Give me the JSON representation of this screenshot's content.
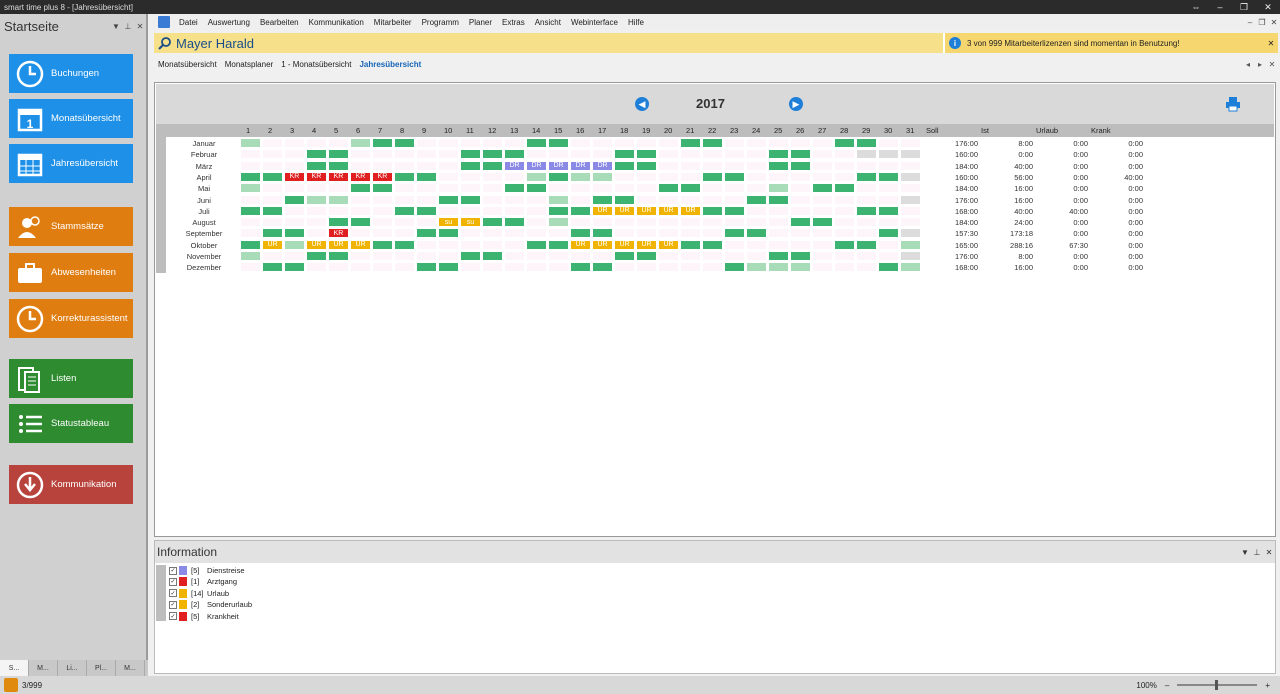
{
  "window": {
    "title": "smart time plus 8 - [Jahresübersicht]"
  },
  "sidebar": {
    "title": "Startseite",
    "buttons": [
      {
        "label": "Buchungen",
        "color": "#1e90e8",
        "icon": "clock-icon"
      },
      {
        "label": "Monatsübersicht",
        "color": "#1e90e8",
        "icon": "calendar-day-icon"
      },
      {
        "label": "Jahresübersicht",
        "color": "#1e90e8",
        "icon": "calendar-grid-icon"
      },
      {
        "label": "Stammsätze",
        "color": "#e07d10",
        "icon": "users-icon"
      },
      {
        "label": "Abwesenheiten",
        "color": "#e07d10",
        "icon": "briefcase-icon"
      },
      {
        "label": "Korrekturassistent",
        "color": "#e07d10",
        "icon": "clock-edit-icon"
      },
      {
        "label": "Listen",
        "color": "#2e8b30",
        "icon": "list-doc-icon"
      },
      {
        "label": "Statustableau",
        "color": "#2e8b30",
        "icon": "list-icon"
      },
      {
        "label": "Kommunikation",
        "color": "#b8433c",
        "icon": "download-icon"
      }
    ],
    "tabs": [
      "S...",
      "M...",
      "Li...",
      "Pl...",
      "M..."
    ]
  },
  "menu": [
    "Datei",
    "Auswertung",
    "Bearbeiten",
    "Kommunikation",
    "Mitarbeiter",
    "Programm",
    "Planer",
    "Extras",
    "Ansicht",
    "Webinterface",
    "Hilfe"
  ],
  "employee": {
    "name": "Mayer Harald"
  },
  "license_notice": "3 von 999 Mitarbeiterlizenzen sind momentan in Benutzung!",
  "subtabs": [
    "Monatsübersicht",
    "Monatsplaner",
    "1 - Monatsübersicht",
    "Jahresübersicht"
  ],
  "year": "2017",
  "columns": {
    "soll": "Soll",
    "ist": "Ist",
    "urlaub": "Urlaub",
    "krank": "Krank"
  },
  "colors": {
    "G": "#3cb371",
    "L": "#a8dbb8",
    "R": "#e02020",
    "Y": "#f0b400",
    "P": "#8a8ae6",
    "X": "#dcdcdc"
  },
  "months": [
    {
      "name": "Januar",
      "cells": [
        "L",
        null,
        null,
        null,
        null,
        "L",
        "G",
        "G",
        null,
        null,
        null,
        null,
        null,
        "G",
        "G",
        null,
        null,
        null,
        null,
        null,
        "G",
        "G",
        null,
        null,
        null,
        null,
        null,
        "G",
        "G",
        null,
        null
      ],
      "labels": {},
      "soll": "176:00",
      "ist": "8:00",
      "urlaub": "0:00",
      "krank": "0:00"
    },
    {
      "name": "Februar",
      "cells": [
        null,
        null,
        null,
        "G",
        "G",
        null,
        null,
        null,
        null,
        null,
        "G",
        "G",
        "G",
        null,
        null,
        null,
        null,
        "G",
        "G",
        null,
        null,
        null,
        null,
        null,
        "G",
        "G",
        null,
        null,
        "X",
        "X",
        "X"
      ],
      "labels": {},
      "soll": "160:00",
      "ist": "0:00",
      "urlaub": "0:00",
      "krank": "0:00"
    },
    {
      "name": "März",
      "cells": [
        null,
        null,
        null,
        "G",
        "G",
        null,
        null,
        null,
        null,
        null,
        "G",
        "G",
        "P",
        "P",
        "P",
        "P",
        "P",
        "G",
        "G",
        null,
        null,
        null,
        null,
        null,
        "G",
        "G",
        null,
        null,
        null,
        null,
        null
      ],
      "labels": {
        "13": "DR",
        "14": "DR",
        "15": "DR",
        "16": "DR",
        "17": "DR"
      },
      "soll": "184:00",
      "ist": "40:00",
      "urlaub": "0:00",
      "krank": "0:00"
    },
    {
      "name": "April",
      "cells": [
        "G",
        "G",
        "R",
        "R",
        "R",
        "R",
        "R",
        "G",
        "G",
        null,
        null,
        null,
        null,
        "L",
        "G",
        "L",
        "L",
        null,
        null,
        null,
        null,
        "G",
        "G",
        null,
        null,
        null,
        null,
        null,
        "G",
        "G",
        "X"
      ],
      "labels": {
        "3": "KR",
        "4": "KR",
        "5": "KR",
        "6": "KR",
        "7": "KR"
      },
      "soll": "160:00",
      "ist": "56:00",
      "urlaub": "0:00",
      "krank": "40:00"
    },
    {
      "name": "Mai",
      "cells": [
        "L",
        null,
        null,
        null,
        null,
        "G",
        "G",
        null,
        null,
        null,
        null,
        null,
        "G",
        "G",
        null,
        null,
        null,
        null,
        null,
        "G",
        "G",
        null,
        null,
        null,
        "L",
        null,
        "G",
        "G",
        null,
        null,
        null
      ],
      "labels": {},
      "soll": "184:00",
      "ist": "16:00",
      "urlaub": "0:00",
      "krank": "0:00"
    },
    {
      "name": "Juni",
      "cells": [
        null,
        null,
        "G",
        "L",
        "L",
        null,
        null,
        null,
        null,
        "G",
        "G",
        null,
        null,
        null,
        "L",
        null,
        "G",
        "G",
        null,
        null,
        null,
        null,
        null,
        "G",
        "G",
        null,
        null,
        null,
        null,
        null,
        "X"
      ],
      "labels": {},
      "soll": "176:00",
      "ist": "16:00",
      "urlaub": "0:00",
      "krank": "0:00"
    },
    {
      "name": "Juli",
      "cells": [
        "G",
        "G",
        null,
        null,
        null,
        null,
        null,
        "G",
        "G",
        null,
        null,
        null,
        null,
        null,
        "G",
        "G",
        "Y",
        "Y",
        "Y",
        "Y",
        "Y",
        "G",
        "G",
        null,
        null,
        null,
        null,
        null,
        "G",
        "G",
        null
      ],
      "labels": {
        "17": "UR",
        "18": "UR",
        "19": "UR",
        "20": "UR",
        "21": "UR"
      },
      "soll": "168:00",
      "ist": "40:00",
      "urlaub": "40:00",
      "krank": "0:00"
    },
    {
      "name": "August",
      "cells": [
        null,
        null,
        null,
        null,
        "G",
        "G",
        null,
        null,
        null,
        "Y",
        "Y",
        "G",
        "G",
        null,
        "L",
        null,
        null,
        null,
        null,
        null,
        null,
        null,
        null,
        null,
        null,
        "G",
        "G",
        null,
        null,
        null,
        null
      ],
      "labels": {
        "10": "su",
        "11": "su"
      },
      "soll": "184:00",
      "ist": "24:00",
      "urlaub": "0:00",
      "krank": "0:00"
    },
    {
      "name": "September",
      "cells": [
        null,
        "G",
        "G",
        null,
        "R",
        null,
        null,
        null,
        "G",
        "G",
        null,
        null,
        null,
        null,
        null,
        "G",
        "G",
        null,
        null,
        null,
        null,
        null,
        "G",
        "G",
        null,
        null,
        null,
        null,
        null,
        "G",
        "X"
      ],
      "labels": {
        "5": "KR"
      },
      "soll": "157:30",
      "ist": "173:18",
      "urlaub": "0:00",
      "krank": "0:00"
    },
    {
      "name": "Oktober",
      "cells": [
        "G",
        "Y",
        "L",
        "Y",
        "Y",
        "Y",
        "G",
        "G",
        null,
        null,
        null,
        null,
        null,
        "G",
        "G",
        "Y",
        "Y",
        "Y",
        "Y",
        "Y",
        "G",
        "G",
        null,
        null,
        null,
        null,
        null,
        "G",
        "G",
        null,
        "L"
      ],
      "labels": {
        "2": "UR",
        "4": "UR",
        "5": "UR",
        "6": "UR",
        "16": "UR",
        "17": "UR",
        "18": "UR",
        "19": "UR",
        "20": "UR"
      },
      "soll": "165:00",
      "ist": "288:16",
      "urlaub": "67:30",
      "krank": "0:00"
    },
    {
      "name": "November",
      "cells": [
        "L",
        null,
        null,
        "G",
        "G",
        null,
        null,
        null,
        null,
        null,
        "G",
        "G",
        null,
        null,
        null,
        null,
        null,
        "G",
        "G",
        null,
        null,
        null,
        null,
        null,
        "G",
        "G",
        null,
        null,
        null,
        null,
        "X"
      ],
      "labels": {},
      "soll": "176:00",
      "ist": "8:00",
      "urlaub": "0:00",
      "krank": "0:00"
    },
    {
      "name": "Dezember",
      "cells": [
        null,
        "G",
        "G",
        null,
        null,
        null,
        null,
        null,
        "G",
        "G",
        null,
        null,
        null,
        null,
        null,
        "G",
        "G",
        null,
        null,
        null,
        null,
        null,
        "G",
        "L",
        "L",
        "L",
        null,
        null,
        null,
        "G",
        "L"
      ],
      "labels": {},
      "soll": "168:00",
      "ist": "16:00",
      "urlaub": "0:00",
      "krank": "0:00"
    }
  ],
  "info": {
    "title": "Information",
    "legend": [
      {
        "count": "[5]",
        "label": "Dienstreise",
        "color": "#8a8ae6"
      },
      {
        "count": "[1]",
        "label": "Arztgang",
        "color": "#e02020"
      },
      {
        "count": "[14]",
        "label": "Urlaub",
        "color": "#f0b400"
      },
      {
        "count": "[2]",
        "label": "Sonderurlaub",
        "color": "#f0b400"
      },
      {
        "count": "[5]",
        "label": "Krankheit",
        "color": "#e02020"
      }
    ]
  },
  "status": {
    "left": "3/999",
    "zoom": "100%"
  }
}
